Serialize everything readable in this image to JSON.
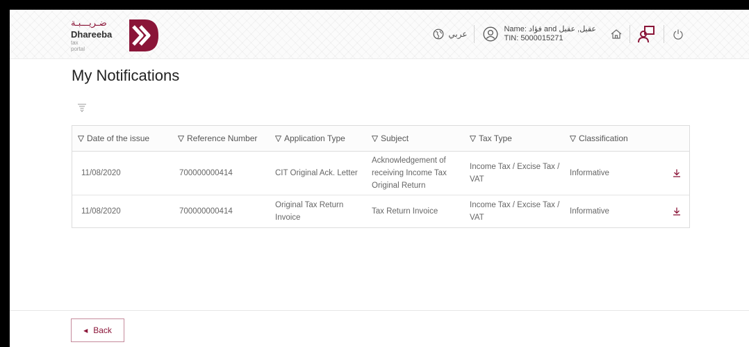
{
  "header": {
    "logo_ar": "ضـريـــبـة",
    "logo_en": "Dhareeba",
    "logo_sub": "tax portal",
    "language_label": "عربي",
    "user_name": "Name: فؤاد and عقيل, عقيل",
    "user_tin": "TIN: 5000015271"
  },
  "page": {
    "title": "My Notifications"
  },
  "table": {
    "columns": [
      "Date of the issue",
      "Reference Number",
      "Application Type",
      "Subject",
      "Tax Type",
      "Classification"
    ],
    "rows": [
      {
        "date": "11/08/2020",
        "reference": "700000000414",
        "application_type": "CIT Original Ack. Letter",
        "subject": "Acknowledgement of receiving Income Tax Original Return",
        "tax_type": "Income Tax / Excise Tax / VAT",
        "classification": "Informative"
      },
      {
        "date": "11/08/2020",
        "reference": "700000000414",
        "application_type": "Original Tax Return Invoice",
        "subject": "Tax Return Invoice",
        "tax_type": "Income Tax / Excise Tax / VAT",
        "classification": "Informative"
      }
    ]
  },
  "footer": {
    "back_label": "Back"
  },
  "colors": {
    "brand": "#8a1538",
    "border": "#dcdcdc"
  },
  "icons": [
    "globe-icon",
    "user-icon",
    "home-icon",
    "people-icon",
    "power-icon",
    "filter-icon",
    "funnel-icon",
    "download-icon"
  ]
}
